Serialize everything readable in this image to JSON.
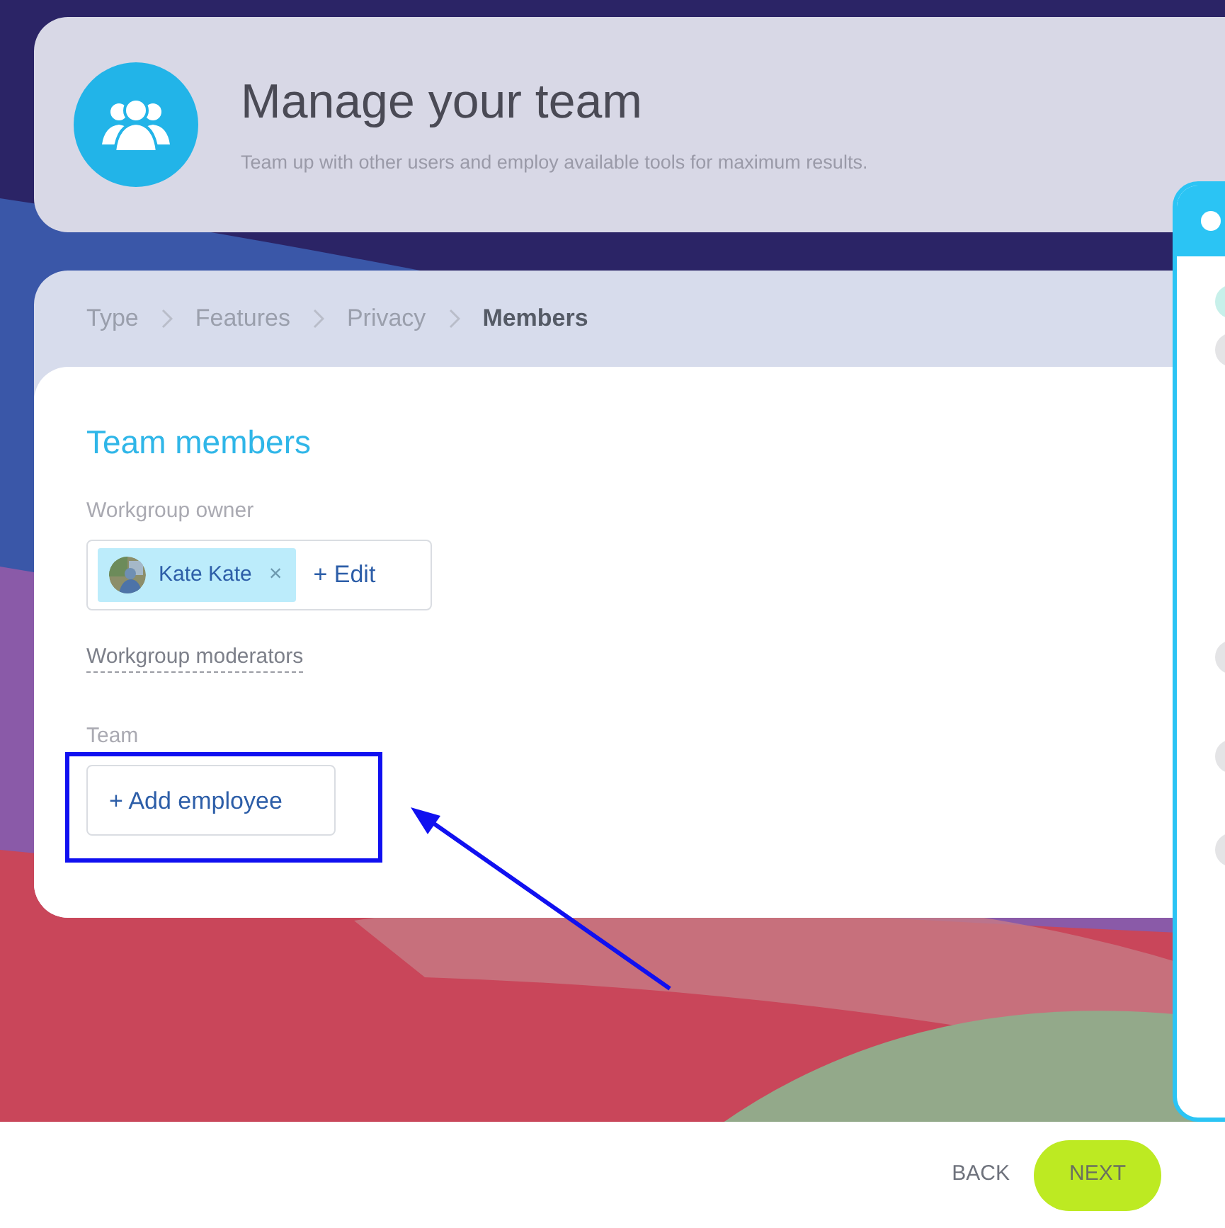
{
  "header": {
    "title": "Manage your team",
    "subtitle": "Team up with other users and employ available tools for maximum results."
  },
  "breadcrumbs": [
    {
      "label": "Type",
      "selected": false
    },
    {
      "label": "Features",
      "selected": false
    },
    {
      "label": "Privacy",
      "selected": false
    },
    {
      "label": "Members",
      "selected": true
    }
  ],
  "section_title": "Team members",
  "owner": {
    "label": "Workgroup owner",
    "name": "Kate Kate",
    "remove": "×",
    "edit": "+ Edit"
  },
  "moderators_link": "Workgroup moderators",
  "team": {
    "label": "Team",
    "add_button": "+ Add employee"
  },
  "footer": {
    "back": "BACK",
    "next": "NEXT"
  }
}
